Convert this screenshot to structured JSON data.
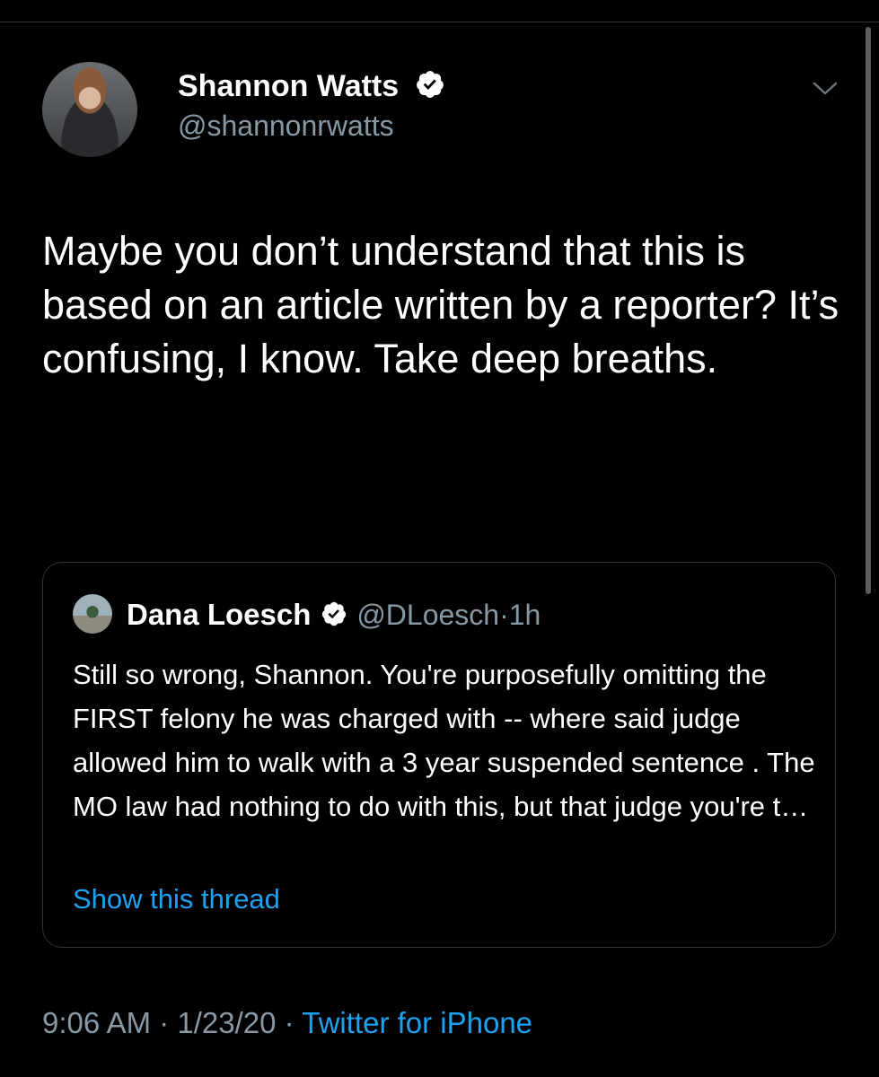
{
  "tweet": {
    "author": {
      "name": "Shannon Watts",
      "handle": "@shannonrwatts"
    },
    "text": "Maybe you don’t understand that this is based on an article written by a reporter? It’s confusing, I know. Take deep breaths.",
    "quoted": {
      "name": "Dana Loesch",
      "handle": "@DLoesch",
      "dot": "·",
      "time": "1h",
      "text": "Still so wrong, Shannon. You're purposefully omitting the FIRST felony he was charged with -- where said judge allowed him to walk with a 3 year suspended sentence . The MO law had nothing to do with this, but that judge you're t…",
      "show_thread": "Show this thread"
    },
    "meta": {
      "time": "9:06 AM",
      "sep1": " · ",
      "date": "1/23/20",
      "sep2": " · ",
      "source": "Twitter for iPhone"
    }
  },
  "icons": {
    "verified": "verified-badge-icon",
    "caret": "chevron-down-icon"
  },
  "colors": {
    "background": "#000000",
    "text": "#ffffff",
    "secondary": "#8899a6",
    "link": "#1da1f2",
    "border": "#2f3336"
  }
}
